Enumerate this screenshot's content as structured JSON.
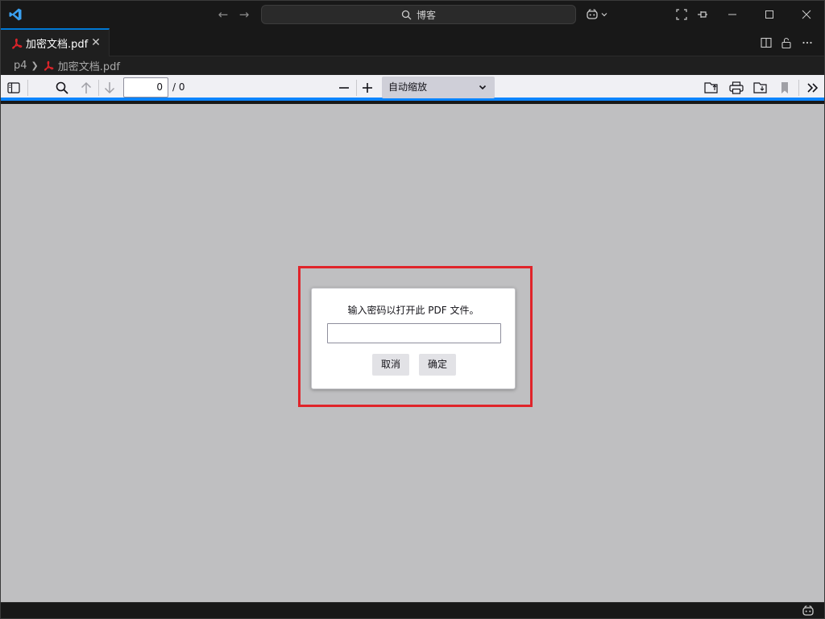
{
  "titlebar": {
    "search_text": "博客",
    "icons": [
      "vscode-logo-icon",
      "back-arrow-icon",
      "forward-arrow-icon",
      "search-icon",
      "copilot-icon",
      "chevron-down-icon",
      "fullscreen-icon",
      "pin-icon",
      "minimize-icon",
      "maximize-icon",
      "close-icon"
    ]
  },
  "tab": {
    "label": "加密文档.pdf",
    "close_glyph": "✕"
  },
  "breadcrumb": {
    "folder": "p4",
    "file": "加密文档.pdf"
  },
  "pdf_toolbar": {
    "page_value": "0",
    "page_count": "/ 0",
    "zoom_label": "自动缩放"
  },
  "dialog": {
    "message": "输入密码以打开此 PDF 文件。",
    "password_value": "",
    "cancel_label": "取消",
    "ok_label": "确定"
  },
  "colors": {
    "accent": "#0078d4",
    "pdf_red": "#e0242a",
    "viewer_bg": "#bfbfc1",
    "toolbar_bg": "#f0f0f4",
    "toolbar_accent": "#0a84ff"
  }
}
